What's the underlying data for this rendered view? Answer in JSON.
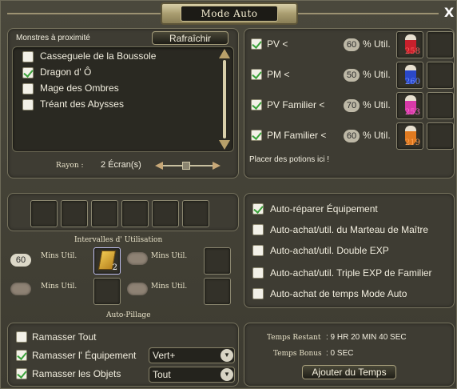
{
  "window": {
    "title": "Mode Auto",
    "close_glyph": "X"
  },
  "monsters": {
    "header": "Monstres à proximité",
    "refresh_label": "Rafraîchir",
    "items": [
      {
        "label": "Casseguele de la Boussole",
        "checked": false
      },
      {
        "label": "Dragon d' Ô",
        "checked": true
      },
      {
        "label": "Mage des Ombres",
        "checked": false
      },
      {
        "label": "Tréant des Abysses",
        "checked": false
      }
    ],
    "radius_label": "Rayon :",
    "radius_value": "2 Écran(s)"
  },
  "potions": {
    "rows": [
      {
        "label": "PV <",
        "value": "60",
        "unit": "% Util.",
        "checked": true,
        "count": "258",
        "color": "#c8202c",
        "icon": "red-potion-icon"
      },
      {
        "label": "PM <",
        "value": "50",
        "unit": "% Util.",
        "checked": true,
        "count": "260",
        "color": "#2a48c8",
        "icon": "blue-potion-icon"
      },
      {
        "label": "PV Familier <",
        "value": "70",
        "unit": "% Util.",
        "checked": true,
        "count": "253",
        "color": "#d83aa8",
        "icon": "pink-potion-icon"
      },
      {
        "label": "PM Familier <",
        "value": "60",
        "unit": "% Util.",
        "checked": true,
        "count": "219",
        "color": "#e07a20",
        "icon": "orange-potion-icon"
      }
    ],
    "hint": "Placer des potions ici !"
  },
  "intervals": {
    "header": "Intervalles d' Utilisation",
    "unit": "Mins Util.",
    "slot1_value": "60",
    "scroll_count": "2"
  },
  "auto_options": {
    "items": [
      {
        "label": "Auto-réparer Équipement",
        "checked": true
      },
      {
        "label": "Auto-achat/util. du Marteau de Maître",
        "checked": false
      },
      {
        "label": "Auto-achat/util. Double EXP",
        "checked": false
      },
      {
        "label": "Auto-achat/util. Triple EXP de Familier",
        "checked": false
      },
      {
        "label": "Auto-achat de temps Mode Auto",
        "checked": false
      }
    ]
  },
  "loot": {
    "header": "Auto-Pillage",
    "items": [
      {
        "label": "Ramasser Tout",
        "checked": false
      },
      {
        "label": "Ramasser l' Équipement",
        "checked": true,
        "select": "Vert+"
      },
      {
        "label": "Ramasser les Objets",
        "checked": true,
        "select": "Tout"
      }
    ]
  },
  "time": {
    "remaining_label": "Temps Restant",
    "remaining_value": ": 9 HR 20 MIN 40 SEC",
    "bonus_label": "Temps Bonus",
    "bonus_value": ": 0 SEC",
    "add_button": "Ajouter du Temps"
  }
}
